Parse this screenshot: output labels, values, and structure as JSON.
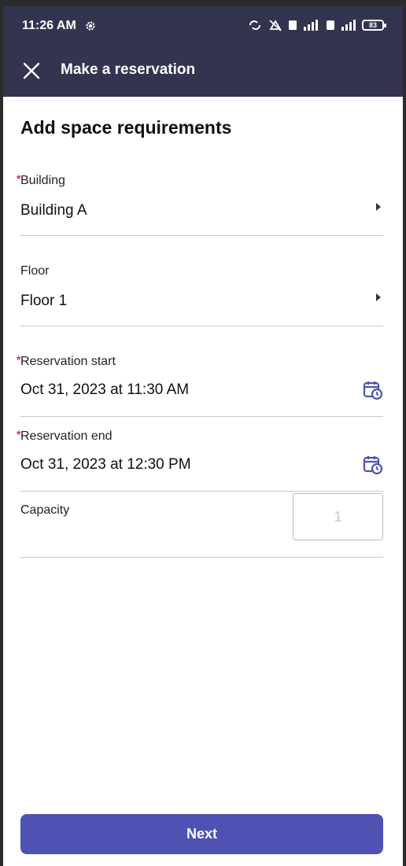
{
  "status_bar": {
    "time": "11:26 AM",
    "battery": "83"
  },
  "toolbar": {
    "title": "Make a reservation",
    "close_icon": "close-icon"
  },
  "form": {
    "section_title": "Add space requirements",
    "required_marker": "*",
    "building": {
      "label": "Building",
      "value": "Building A",
      "required": true
    },
    "floor": {
      "label": "Floor",
      "value": "Floor 1",
      "required": false
    },
    "reservation_start": {
      "label": "Reservation start",
      "value": "Oct 31, 2023 at 11:30 AM",
      "required": true
    },
    "reservation_end": {
      "label": "Reservation end",
      "value": "Oct 31, 2023 at 12:30 PM",
      "required": true
    },
    "capacity": {
      "label": "Capacity",
      "placeholder": "1"
    }
  },
  "footer": {
    "next_label": "Next"
  },
  "colors": {
    "app_bar": "#33344f",
    "accent": "#4f52b2",
    "required": "#d13438"
  }
}
